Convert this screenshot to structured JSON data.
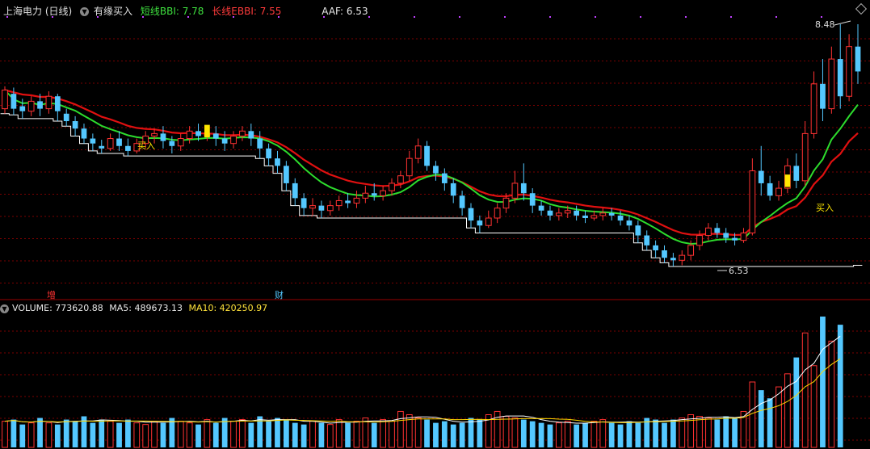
{
  "header": {
    "title": "上海电力 (日线)",
    "indicator": "有缘买入",
    "short_bbi_label": "短线BBI: 7.78",
    "long_ebbi_label": "长线EBBI: 7.55",
    "aaf_label": "AAF: 6.53"
  },
  "volume_header": {
    "volume_label": "VOLUME: 773620.88",
    "ma5_label": "MA5: 489673.13",
    "ma10_label": "MA10: 420250.97"
  },
  "markers": {
    "buy_1": "买入",
    "buy_2": "买入",
    "increase": "增",
    "finance": "财",
    "high_label": "8.48",
    "low_label": "6.53"
  },
  "colors": {
    "up": "#ff3232",
    "down": "#54c8ff",
    "short_bbi": "#2ddc2d",
    "long_ebbi": "#e01010",
    "support": "#ffffff",
    "buy_bar": "#ffe600",
    "grid": "#7a0000",
    "ma5": "#ffffff",
    "ma10": "#ffd700"
  },
  "chart_data": {
    "type": "candlestick",
    "price_range": [
      6.53,
      8.48
    ],
    "candles": [
      [
        7.8,
        7.95,
        7.76,
        7.98
      ],
      [
        7.92,
        7.8,
        7.75,
        7.97
      ],
      [
        7.82,
        7.78,
        7.72,
        7.88
      ],
      [
        7.78,
        7.86,
        7.74,
        7.9
      ],
      [
        7.86,
        7.8,
        7.74,
        7.92
      ],
      [
        7.8,
        7.9,
        7.76,
        7.94
      ],
      [
        7.9,
        7.78,
        7.7,
        7.92
      ],
      [
        7.76,
        7.7,
        7.66,
        7.8
      ],
      [
        7.7,
        7.64,
        7.58,
        7.74
      ],
      [
        7.64,
        7.56,
        7.52,
        7.68
      ],
      [
        7.56,
        7.52,
        7.46,
        7.6
      ],
      [
        7.5,
        7.48,
        7.44,
        7.55
      ],
      [
        7.48,
        7.56,
        7.46,
        7.6
      ],
      [
        7.56,
        7.5,
        7.46,
        7.62
      ],
      [
        7.5,
        7.46,
        7.42,
        7.56
      ],
      [
        7.46,
        7.52,
        7.44,
        7.56
      ],
      [
        7.52,
        7.58,
        7.48,
        7.62
      ],
      [
        7.58,
        7.6,
        7.52,
        7.64
      ],
      [
        7.6,
        7.54,
        7.48,
        7.66
      ],
      [
        7.54,
        7.5,
        7.44,
        7.58
      ],
      [
        7.5,
        7.56,
        7.46,
        7.6
      ],
      [
        7.56,
        7.62,
        7.52,
        7.66
      ],
      [
        7.62,
        7.58,
        7.54,
        7.68
      ],
      [
        7.58,
        7.6,
        7.54,
        7.64
      ],
      [
        7.6,
        7.56,
        7.5,
        7.66
      ],
      [
        7.56,
        7.52,
        7.46,
        7.62
      ],
      [
        7.52,
        7.58,
        7.48,
        7.62
      ],
      [
        7.58,
        7.62,
        7.54,
        7.66
      ],
      [
        7.62,
        7.56,
        7.5,
        7.68
      ],
      [
        7.56,
        7.48,
        7.4,
        7.62
      ],
      [
        7.48,
        7.4,
        7.34,
        7.52
      ],
      [
        7.4,
        7.34,
        7.28,
        7.46
      ],
      [
        7.34,
        7.2,
        7.14,
        7.38
      ],
      [
        7.2,
        7.08,
        7.02,
        7.24
      ],
      [
        7.08,
        7.0,
        6.94,
        7.12
      ],
      [
        7.0,
        7.02,
        6.94,
        7.08
      ],
      [
        7.02,
        6.98,
        6.92,
        7.06
      ],
      [
        6.98,
        7.02,
        6.94,
        7.06
      ],
      [
        7.02,
        7.06,
        6.98,
        7.1
      ],
      [
        7.06,
        7.04,
        7.0,
        7.12
      ],
      [
        7.04,
        7.08,
        7.0,
        7.14
      ],
      [
        7.08,
        7.12,
        7.04,
        7.18
      ],
      [
        7.12,
        7.1,
        7.06,
        7.2
      ],
      [
        7.1,
        7.14,
        7.06,
        7.18
      ],
      [
        7.14,
        7.2,
        7.1,
        7.24
      ],
      [
        7.2,
        7.26,
        7.16,
        7.3
      ],
      [
        7.26,
        7.4,
        7.22,
        7.46
      ],
      [
        7.4,
        7.5,
        7.36,
        7.56
      ],
      [
        7.5,
        7.34,
        7.3,
        7.54
      ],
      [
        7.34,
        7.28,
        7.22,
        7.38
      ],
      [
        7.28,
        7.2,
        7.14,
        7.32
      ],
      [
        7.2,
        7.1,
        7.04,
        7.24
      ],
      [
        7.1,
        7.0,
        6.94,
        7.14
      ],
      [
        7.0,
        6.9,
        6.84,
        7.04
      ],
      [
        6.9,
        6.86,
        6.8,
        6.94
      ],
      [
        6.86,
        6.92,
        6.84,
        6.98
      ],
      [
        6.92,
        7.0,
        6.88,
        7.04
      ],
      [
        7.0,
        7.08,
        6.96,
        7.12
      ],
      [
        7.08,
        7.2,
        7.04,
        7.3
      ],
      [
        7.2,
        7.12,
        7.06,
        7.36
      ],
      [
        7.12,
        7.02,
        6.96,
        7.16
      ],
      [
        7.02,
        6.98,
        6.94,
        7.06
      ],
      [
        6.98,
        6.94,
        6.9,
        7.02
      ],
      [
        6.94,
        6.96,
        6.9,
        7.0
      ],
      [
        6.96,
        6.98,
        6.92,
        7.02
      ],
      [
        6.98,
        6.94,
        6.9,
        7.02
      ],
      [
        6.94,
        6.92,
        6.88,
        6.98
      ],
      [
        6.92,
        6.94,
        6.9,
        6.98
      ],
      [
        6.94,
        6.96,
        6.9,
        7.0
      ],
      [
        6.96,
        6.94,
        6.9,
        7.0
      ],
      [
        6.94,
        6.9,
        6.86,
        6.98
      ],
      [
        6.9,
        6.86,
        6.82,
        6.94
      ],
      [
        6.86,
        6.78,
        6.72,
        6.9
      ],
      [
        6.78,
        6.7,
        6.66,
        6.82
      ],
      [
        6.7,
        6.66,
        6.6,
        6.74
      ],
      [
        6.66,
        6.6,
        6.56,
        6.7
      ],
      [
        6.6,
        6.58,
        6.53,
        6.64
      ],
      [
        6.58,
        6.62,
        6.54,
        6.66
      ],
      [
        6.62,
        6.7,
        6.58,
        6.74
      ],
      [
        6.7,
        6.78,
        6.66,
        6.82
      ],
      [
        6.78,
        6.84,
        6.74,
        6.88
      ],
      [
        6.84,
        6.8,
        6.76,
        6.88
      ],
      [
        6.8,
        6.76,
        6.72,
        6.84
      ],
      [
        6.76,
        6.74,
        6.7,
        6.8
      ],
      [
        6.74,
        6.8,
        6.72,
        6.84
      ],
      [
        6.8,
        7.3,
        6.78,
        7.4
      ],
      [
        7.3,
        7.2,
        7.1,
        7.5
      ],
      [
        7.2,
        7.1,
        7.06,
        7.26
      ],
      [
        7.1,
        7.16,
        7.06,
        7.22
      ],
      [
        7.16,
        7.34,
        7.12,
        7.4
      ],
      [
        7.34,
        7.22,
        7.16,
        7.44
      ],
      [
        7.22,
        7.6,
        7.18,
        7.7
      ],
      [
        7.6,
        8.0,
        7.56,
        8.1
      ],
      [
        8.0,
        7.8,
        7.7,
        8.2
      ],
      [
        7.8,
        8.2,
        7.76,
        8.3
      ],
      [
        8.2,
        7.9,
        7.8,
        8.48
      ],
      [
        7.9,
        8.3,
        7.86,
        8.4
      ],
      [
        8.3,
        8.1,
        8.0,
        8.48
      ]
    ],
    "volume": [
      32,
      34,
      28,
      30,
      36,
      30,
      28,
      34,
      32,
      38,
      30,
      34,
      32,
      30,
      34,
      30,
      28,
      32,
      30,
      36,
      32,
      30,
      28,
      34,
      30,
      36,
      32,
      34,
      30,
      38,
      32,
      36,
      34,
      30,
      28,
      32,
      30,
      28,
      34,
      30,
      32,
      36,
      30,
      34,
      32,
      44,
      40,
      36,
      34,
      30,
      32,
      28,
      30,
      36,
      34,
      40,
      44,
      38,
      36,
      34,
      32,
      30,
      28,
      30,
      32,
      28,
      30,
      32,
      34,
      30,
      28,
      32,
      30,
      36,
      34,
      30,
      34,
      36,
      40,
      38,
      36,
      34,
      38,
      36,
      44,
      80,
      70,
      60,
      74,
      90,
      110,
      140,
      100,
      160,
      130,
      150
    ]
  }
}
